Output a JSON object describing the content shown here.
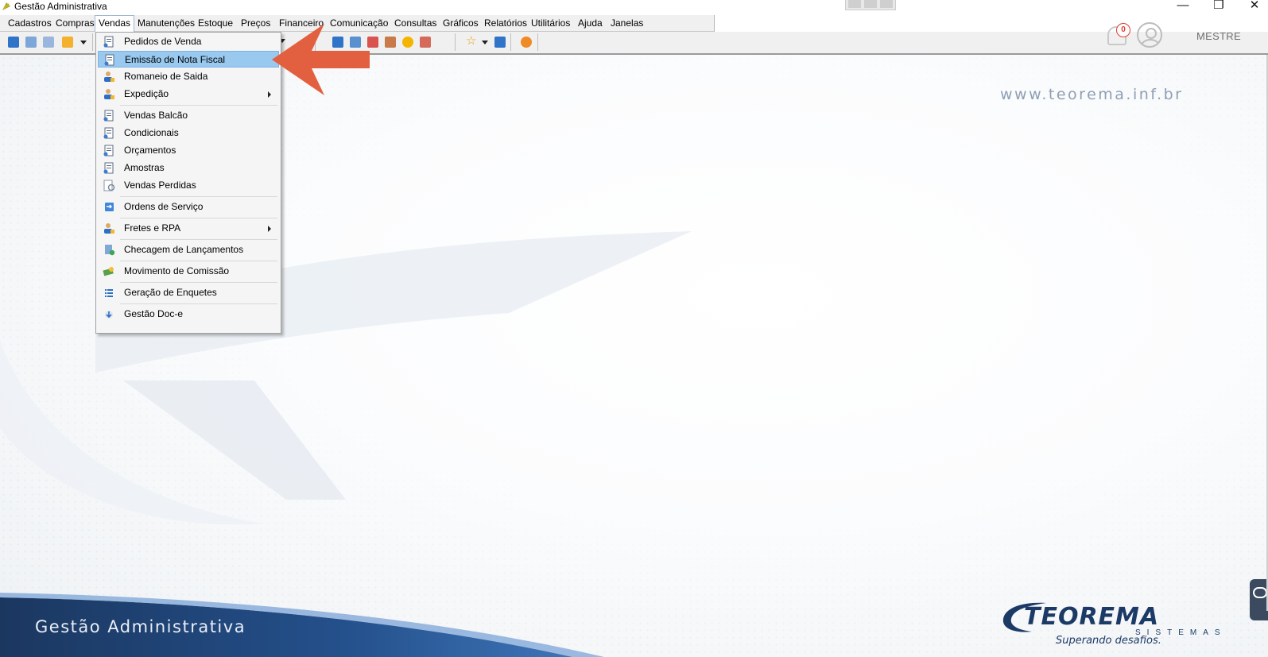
{
  "window": {
    "title": "Gestão Administrativa",
    "minimize": "—",
    "maximize": "❐",
    "close": "✕"
  },
  "menubar": [
    {
      "label": "Cadastros"
    },
    {
      "label": "Compras"
    },
    {
      "label": "Vendas",
      "active": true
    },
    {
      "label": "Manutenções"
    },
    {
      "label": "Estoque"
    },
    {
      "label": "Preços"
    },
    {
      "label": "Financeiro"
    },
    {
      "label": "Comunicação"
    },
    {
      "label": "Consultas"
    },
    {
      "label": "Gráficos"
    },
    {
      "label": "Relatórios"
    },
    {
      "label": "Utilitários"
    },
    {
      "label": "Ajuda"
    },
    {
      "label": "Janelas"
    }
  ],
  "notifications": {
    "count": "0"
  },
  "user": {
    "name": "MESTRE"
  },
  "vendas_menu": {
    "items": [
      {
        "label": "Pedidos de Venda",
        "icon": "sales-document-icon"
      },
      {
        "label": "Emissão de Nota Fiscal",
        "icon": "sales-document-icon",
        "highlighted": true
      },
      {
        "label": "Romaneio de Saida",
        "icon": "person-icon"
      },
      {
        "label": "Expedição",
        "icon": "person-icon",
        "submenu": true
      },
      {
        "label": "Vendas Balcão",
        "icon": "sales-document-icon"
      },
      {
        "label": "Condicionais",
        "icon": "sales-document-icon"
      },
      {
        "label": "Orçamentos",
        "icon": "sales-document-icon"
      },
      {
        "label": "Amostras",
        "icon": "sales-document-icon"
      },
      {
        "label": "Vendas Perdidas",
        "icon": "lost-sales-icon"
      },
      {
        "label": "Ordens de Serviço",
        "icon": "service-order-icon"
      },
      {
        "label": "Fretes e RPA",
        "icon": "person-icon",
        "submenu": true
      },
      {
        "label": "Checagem de Lançamentos",
        "icon": "check-document-icon"
      },
      {
        "label": "Movimento de Comissão",
        "icon": "money-icon"
      },
      {
        "label": "Geração de Enquetes",
        "icon": "list-icon"
      },
      {
        "label": "Gestão Doc-e",
        "icon": "doc-e-icon"
      }
    ]
  },
  "background": {
    "website": "www.teorema.inf.br",
    "caption": "Gestão Administrativa",
    "brand_name": "TEOREMA",
    "brand_sub": "SISTEMAS",
    "brand_tagline": "Superando desafios."
  },
  "colors": {
    "highlight": "#99c9ef",
    "arrow": "#e2603f",
    "band_dark": "#1b3760",
    "notification_badge": "#e23b2e"
  }
}
